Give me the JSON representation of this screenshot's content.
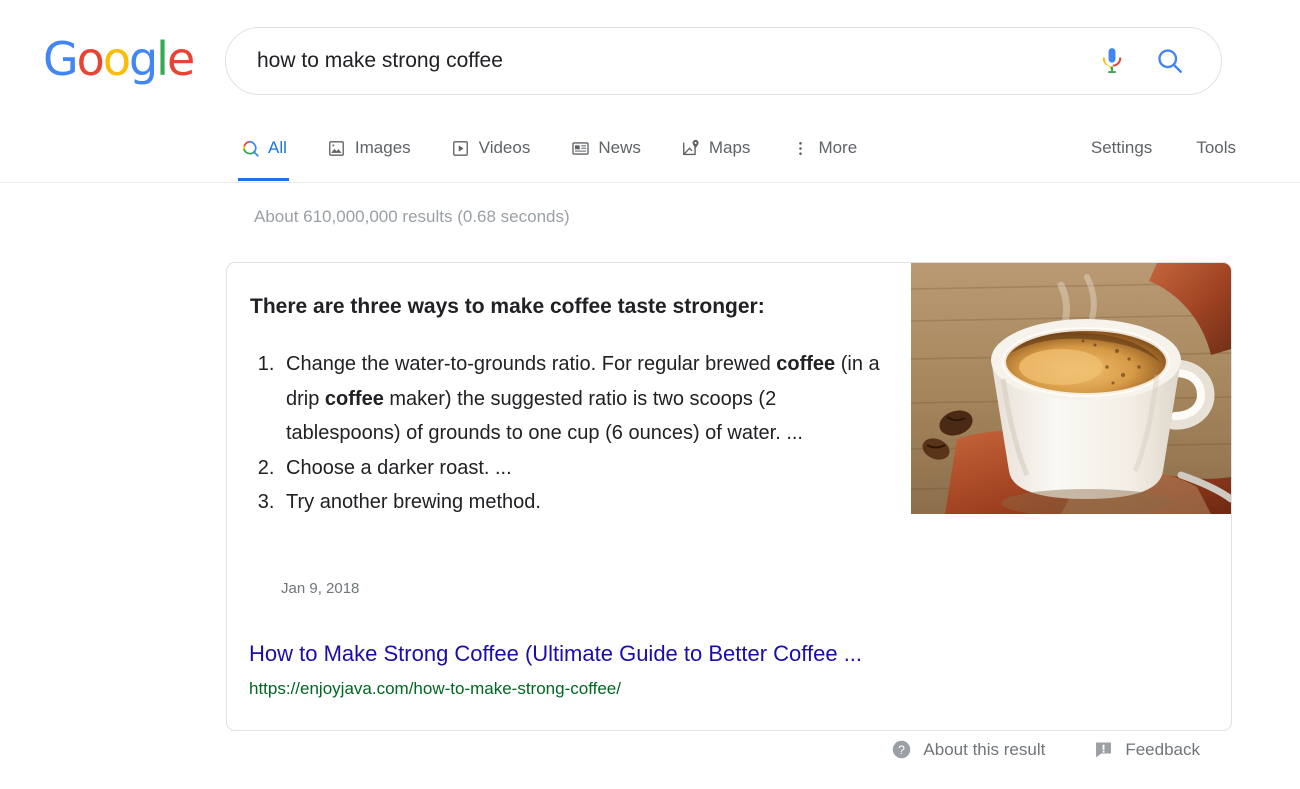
{
  "brand": {
    "name": "Google",
    "letters": [
      {
        "ch": "G",
        "color": "#4285F4"
      },
      {
        "ch": "o",
        "color": "#EA4335"
      },
      {
        "ch": "o",
        "color": "#FBBC05"
      },
      {
        "ch": "g",
        "color": "#4285F4"
      },
      {
        "ch": "l",
        "color": "#34A853"
      },
      {
        "ch": "e",
        "color": "#EA4335"
      }
    ]
  },
  "search": {
    "query": "how to make strong coffee",
    "placeholder": "Search",
    "mic_icon": "microphone-icon",
    "search_icon": "search-icon",
    "accent": "#4285F4"
  },
  "nav": {
    "tabs": [
      {
        "label": "All",
        "icon": "search-icon",
        "active": true
      },
      {
        "label": "Images",
        "icon": "image-icon",
        "active": false
      },
      {
        "label": "Videos",
        "icon": "video-icon",
        "active": false
      },
      {
        "label": "News",
        "icon": "news-icon",
        "active": false
      },
      {
        "label": "Maps",
        "icon": "map-pin-icon",
        "active": false
      },
      {
        "label": "More",
        "icon": "more-vertical-icon",
        "active": false
      }
    ],
    "right_links": [
      {
        "label": "Settings"
      },
      {
        "label": "Tools"
      }
    ],
    "active_color": "#1a73e8"
  },
  "results": {
    "stats": "About 610,000,000 results (0.68 seconds)",
    "featured_snippet": {
      "title": "There are three ways to make coffee taste stronger:",
      "items": [
        {
          "parts": [
            {
              "text": "Change the water-to-grounds ratio. For regular brewed ",
              "bold": false
            },
            {
              "text": "coffee",
              "bold": true
            },
            {
              "text": " (in a drip ",
              "bold": false
            },
            {
              "text": "coffee",
              "bold": true
            },
            {
              "text": " maker) the suggested ratio is two scoops (2 tablespoons) of grounds to one cup (6 ounces) of water. ...",
              "bold": false
            }
          ]
        },
        {
          "parts": [
            {
              "text": "Choose a darker roast. ...",
              "bold": false
            }
          ]
        },
        {
          "parts": [
            {
              "text": "Try another brewing method.",
              "bold": false
            }
          ]
        }
      ],
      "date": "Jan 9, 2018",
      "link_title": "How to Make Strong Coffee (Ultimate Guide to Better Coffee ...",
      "url": "https://enjoyjava.com/how-to-make-strong-coffee/",
      "image_alt": "coffee-cup-photo",
      "link_color": "#1a0dab",
      "url_color": "#006621"
    }
  },
  "footer": {
    "about_label": "About this result",
    "about_icon": "question-mark-icon",
    "feedback_label": "Feedback",
    "feedback_icon": "feedback-icon"
  }
}
